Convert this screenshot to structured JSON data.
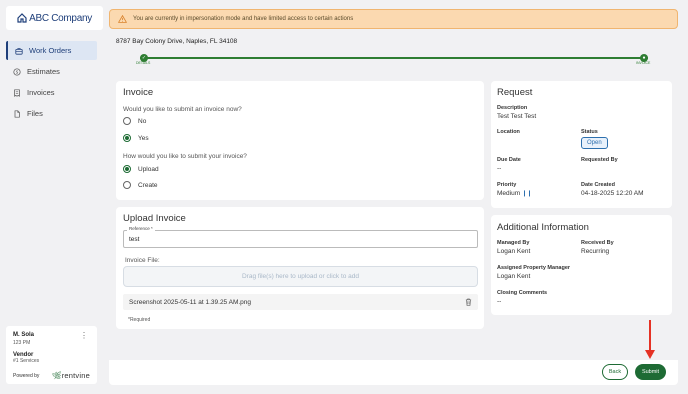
{
  "app": {
    "logo_text": "ABC Company"
  },
  "sidebar": {
    "items": [
      {
        "label": "Work Orders",
        "icon": "briefcase-icon",
        "active": true
      },
      {
        "label": "Estimates",
        "icon": "dollar-circle-icon",
        "active": false
      },
      {
        "label": "Invoices",
        "icon": "receipt-icon",
        "active": false
      },
      {
        "label": "Files",
        "icon": "file-icon",
        "active": false
      }
    ],
    "user": {
      "name": "M. Sola",
      "time": "123 PM",
      "role": "Vendor",
      "company": "#1 Services",
      "powered_by": "Powered by",
      "brand": "rentvine"
    }
  },
  "banner": {
    "text": "You are currently in impersonation mode and have limited access to certain actions"
  },
  "property": {
    "address": "8787 Bay Colony Drive, Naples, FL 34108"
  },
  "progress": {
    "start_label": "DETAILS",
    "end_label": "INVOICE"
  },
  "invoice": {
    "title": "Invoice",
    "q1": "Would you like to submit an invoice now?",
    "opt_no": "No",
    "opt_yes": "Yes",
    "q2": "How would you like to submit your invoice?",
    "opt_upload": "Upload",
    "opt_create": "Create"
  },
  "upload": {
    "title": "Upload Invoice",
    "reference_label": "Reference *",
    "reference_value": "test",
    "file_label": "Invoice File:",
    "dropzone_text": "Drag file(s) here to upload or click to add",
    "file_name": "Screenshot 2025-05-11 at 1.39.25 AM.png",
    "required_note": "*Required"
  },
  "request": {
    "title": "Request",
    "description_label": "Description",
    "description_value": "Test Test Test",
    "location_label": "Location",
    "status_label": "Status",
    "status_value": "Open",
    "due_date_label": "Due Date",
    "due_date_value": "--",
    "requested_by_label": "Requested By",
    "priority_label": "Priority",
    "priority_value": "Medium",
    "date_created_label": "Date Created",
    "date_created_value": "04-18-2025 12:20 AM"
  },
  "additional": {
    "title": "Additional Information",
    "managed_by_label": "Managed By",
    "managed_by_value": "Logan Kent",
    "received_by_label": "Received By",
    "received_by_value": "Recurring",
    "assigned_pm_label": "Assigned Property Manager",
    "assigned_pm_value": "Logan Kent",
    "closing_label": "Closing Comments",
    "closing_value": "--"
  },
  "actions": {
    "back": "Back",
    "submit": "Submit"
  },
  "colors": {
    "primary_green": "#1e6b34",
    "brand_blue": "#1f3f7a",
    "warning_bg": "#fbd9b0",
    "annotation_red": "#e53224"
  }
}
